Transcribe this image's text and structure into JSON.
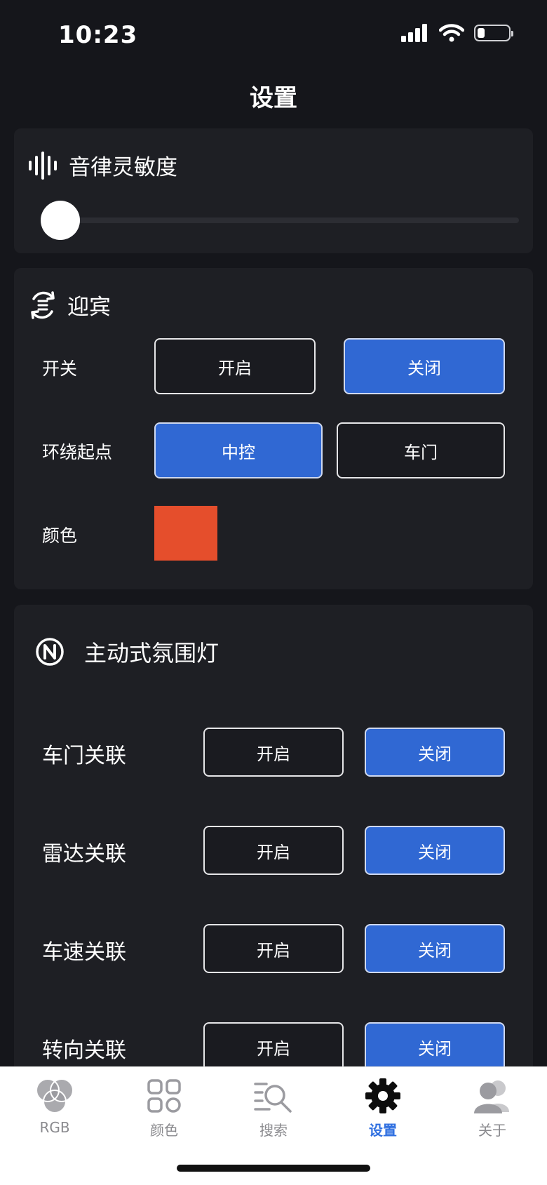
{
  "status_bar": {
    "time": "10:23"
  },
  "page": {
    "title": "设置"
  },
  "sensitivity": {
    "title": "音律灵敏度",
    "level": 0
  },
  "welcome": {
    "title": "迎宾",
    "switch": {
      "label": "开关",
      "on_label": "开启",
      "off_label": "关闭",
      "selected": "关闭"
    },
    "start_point": {
      "label": "环绕起点",
      "option_a": "中控",
      "option_b": "车门",
      "selected": "中控"
    },
    "color": {
      "label": "颜色",
      "value": "#e54e2c"
    }
  },
  "ambient": {
    "title": "主动式氛围灯",
    "rows": [
      {
        "label": "车门关联",
        "on_label": "开启",
        "off_label": "关闭",
        "selected": "关闭"
      },
      {
        "label": "雷达关联",
        "on_label": "开启",
        "off_label": "关闭",
        "selected": "关闭"
      },
      {
        "label": "车速关联",
        "on_label": "开启",
        "off_label": "关闭",
        "selected": "关闭"
      },
      {
        "label": "转向关联",
        "on_label": "开启",
        "off_label": "关闭",
        "selected": "关闭"
      }
    ]
  },
  "tabs": [
    {
      "label": "RGB",
      "icon": "rgb-circles-icon"
    },
    {
      "label": "颜色",
      "icon": "grid-icon"
    },
    {
      "label": "搜索",
      "icon": "search-list-icon"
    },
    {
      "label": "设置",
      "icon": "gear-icon",
      "active": true
    },
    {
      "label": "关于",
      "icon": "users-icon"
    }
  ],
  "colors": {
    "accent": "#3068d3",
    "active_tab": "#2f6fe0",
    "background": "#15161b",
    "card": "#1e1f24"
  }
}
